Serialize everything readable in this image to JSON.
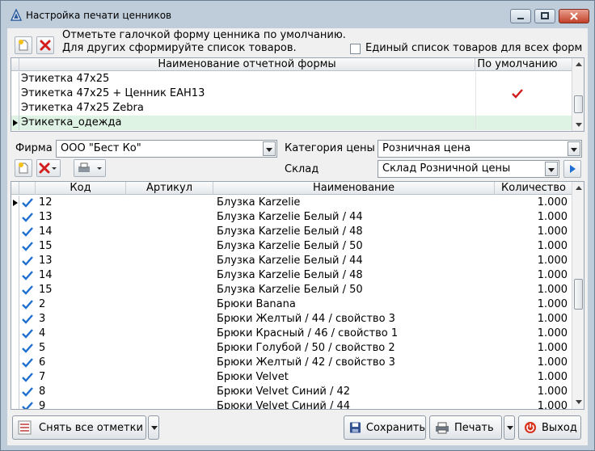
{
  "window": {
    "title": "Настройка печати ценников"
  },
  "hint": {
    "line1": "Отметьте галочкой форму ценника по умолчанию.",
    "line2": "Для других сформируйте список товаров."
  },
  "single_list": {
    "label": "Единый список товаров для всех форм",
    "checked": false
  },
  "forms_grid": {
    "headers": {
      "name": "Наименование отчетной формы",
      "default": "По умолчанию"
    },
    "rows": [
      {
        "name": "Этикетка 47x25",
        "default": false,
        "selected": false
      },
      {
        "name": "Этикетка 47x25 + Ценник EAH13",
        "default": true,
        "selected": false
      },
      {
        "name": "Этикетка 47x25 Zebra",
        "default": false,
        "selected": false
      },
      {
        "name": "Этикетка_одежда",
        "default": false,
        "selected": true
      }
    ]
  },
  "filters": {
    "firm_label": "Фирма",
    "firm_value": "ООО \"Бест Ко\"",
    "price_category_label": "Категория цены",
    "price_category_value": "Розничная цена",
    "warehouse_label": "Склад",
    "warehouse_value": "Склад Розничной цены"
  },
  "items_grid": {
    "headers": {
      "code": "Код",
      "article": "Артикул",
      "name": "Наименование",
      "qty": "Количество"
    },
    "rows": [
      {
        "code": "12",
        "article": "",
        "name": "Блузка Karzelie",
        "qty": "1.000"
      },
      {
        "code": "13",
        "article": "",
        "name": "Блузка Karzelie Белый / 44",
        "qty": "1.000"
      },
      {
        "code": "14",
        "article": "",
        "name": "Блузка Karzelie Белый / 48",
        "qty": "1.000"
      },
      {
        "code": "15",
        "article": "",
        "name": "Блузка Karzelie Белый / 50",
        "qty": "1.000"
      },
      {
        "code": "13",
        "article": "",
        "name": "Блузка Karzelie Белый / 44",
        "qty": "1.000"
      },
      {
        "code": "14",
        "article": "",
        "name": "Блузка Karzelie Белый / 48",
        "qty": "1.000"
      },
      {
        "code": "15",
        "article": "",
        "name": "Блузка Karzelie Белый / 50",
        "qty": "1.000"
      },
      {
        "code": "2",
        "article": "",
        "name": "Брюки Banana",
        "qty": "1.000"
      },
      {
        "code": "3",
        "article": "",
        "name": "Брюки Желтый / 44 / свойство 3",
        "qty": "1.000"
      },
      {
        "code": "4",
        "article": "",
        "name": "Брюки Красный / 46 / свойство 1",
        "qty": "1.000"
      },
      {
        "code": "5",
        "article": "",
        "name": "Брюки Голубой / 50 / свойство 2",
        "qty": "1.000"
      },
      {
        "code": "6",
        "article": "",
        "name": "Брюки Желтый / 42 / свойство 3",
        "qty": "1.000"
      },
      {
        "code": "7",
        "article": "",
        "name": "Брюки Velvet",
        "qty": "1.000"
      },
      {
        "code": "8",
        "article": "",
        "name": "Брюки Velvet Синий / 42",
        "qty": "1.000"
      },
      {
        "code": "9",
        "article": "",
        "name": "Брюки Velvet Синий / 44",
        "qty": "1.000"
      }
    ]
  },
  "buttons": {
    "uncheck_all": "Снять все отметки",
    "save": "Сохранить",
    "print": "Печать",
    "exit": "Выход"
  },
  "colors": {
    "selected_row": "#dff3e4",
    "check_blue": "#1f6fd1",
    "check_red": "#d01c1c",
    "window_frame": "#bfcddb"
  }
}
